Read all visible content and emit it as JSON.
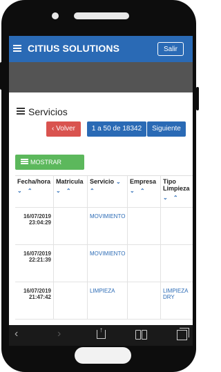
{
  "app": {
    "title": "CITIUS SOLUTIONS",
    "logout_label": "Salir"
  },
  "section": {
    "title": "Servicios"
  },
  "pagination": {
    "back_label": "‹ Volver",
    "range_label": "1 a 50 de 18342",
    "next_label": "Siguiente"
  },
  "filters": {
    "label": "MOSTRAR FILTROS"
  },
  "table": {
    "columns": [
      "Fecha/hora",
      "Matricula",
      "Servicio",
      "Empresa",
      "Tipo Limpieza"
    ],
    "sort_glyphs": "⌄ ⌃",
    "rows": [
      {
        "date": "16/07/2019",
        "time": "23:04:29",
        "matricula": "",
        "servicio": "MOVIMIENTO",
        "empresa": "",
        "tipo": ""
      },
      {
        "date": "16/07/2019",
        "time": "22:21:39",
        "matricula": "",
        "servicio": "MOVIMIENTO",
        "empresa": "",
        "tipo": ""
      },
      {
        "date": "16/07/2019",
        "time": "21:47:42",
        "matricula": "",
        "servicio": "LIMPIEZA",
        "empresa": "",
        "tipo": "LIMPIEZA DRY"
      }
    ]
  },
  "browser": {
    "back": "‹",
    "forward": "›",
    "share_arrow": "↑"
  },
  "colors": {
    "header_blue": "#2a6ab5",
    "danger_red": "#d9534f",
    "success_green": "#5cb85c",
    "dark_band": "#545454"
  }
}
